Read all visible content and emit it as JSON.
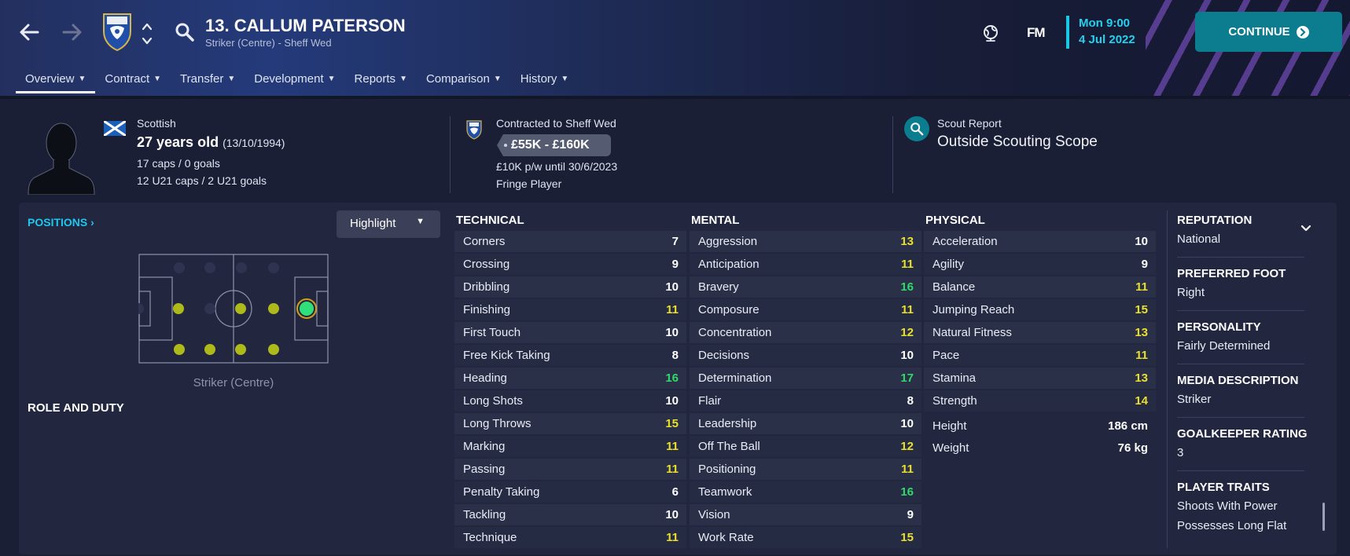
{
  "header": {
    "player_title": "13. CALLUM PATERSON",
    "player_subtitle": "Striker (Centre) - Sheff Wed",
    "back_icon": "arrow-left-icon",
    "forward_icon": "arrow-right-icon",
    "club_crest": "sheff-wed-crest-icon",
    "fm_logo": "FM",
    "date_time": "Mon 9:00",
    "date_day": "4 Jul 2022",
    "continue_label": "CONTINUE"
  },
  "tabs": [
    {
      "label": "Overview",
      "active": true
    },
    {
      "label": "Contract"
    },
    {
      "label": "Transfer"
    },
    {
      "label": "Development"
    },
    {
      "label": "Reports"
    },
    {
      "label": "Comparison"
    },
    {
      "label": "History"
    }
  ],
  "info": {
    "nationality": "Scottish",
    "age": "27 years old",
    "dob": "(13/10/1994)",
    "caps": "17 caps / 0 goals",
    "u21_caps": "12 U21 caps / 2 U21 goals",
    "contracted_to": "Contracted to Sheff Wed",
    "value": "£55K - £160K",
    "wage": "£10K p/w until 30/6/2023",
    "squad_status": "Fringe Player",
    "scout_label": "Scout Report",
    "scout_value": "Outside Scouting Scope"
  },
  "positions": {
    "link_label": "POSITIONS",
    "highlight_label": "Highlight",
    "position_label": "Striker (Centre)",
    "role_duty_label": "ROLE AND DUTY"
  },
  "technical": {
    "heading": "TECHNICAL",
    "rows": [
      {
        "name": "Corners",
        "value": "7",
        "tone": "white"
      },
      {
        "name": "Crossing",
        "value": "9",
        "tone": "white"
      },
      {
        "name": "Dribbling",
        "value": "10",
        "tone": "white"
      },
      {
        "name": "Finishing",
        "value": "11",
        "tone": "yellow"
      },
      {
        "name": "First Touch",
        "value": "10",
        "tone": "white"
      },
      {
        "name": "Free Kick Taking",
        "value": "8",
        "tone": "white"
      },
      {
        "name": "Heading",
        "value": "16",
        "tone": "green"
      },
      {
        "name": "Long Shots",
        "value": "10",
        "tone": "white"
      },
      {
        "name": "Long Throws",
        "value": "15",
        "tone": "yellow"
      },
      {
        "name": "Marking",
        "value": "11",
        "tone": "yellow"
      },
      {
        "name": "Passing",
        "value": "11",
        "tone": "yellow"
      },
      {
        "name": "Penalty Taking",
        "value": "6",
        "tone": "white"
      },
      {
        "name": "Tackling",
        "value": "10",
        "tone": "white"
      },
      {
        "name": "Technique",
        "value": "11",
        "tone": "yellow"
      }
    ]
  },
  "mental": {
    "heading": "MENTAL",
    "rows": [
      {
        "name": "Aggression",
        "value": "13",
        "tone": "yellow"
      },
      {
        "name": "Anticipation",
        "value": "11",
        "tone": "yellow"
      },
      {
        "name": "Bravery",
        "value": "16",
        "tone": "green"
      },
      {
        "name": "Composure",
        "value": "11",
        "tone": "yellow"
      },
      {
        "name": "Concentration",
        "value": "12",
        "tone": "yellow"
      },
      {
        "name": "Decisions",
        "value": "10",
        "tone": "white"
      },
      {
        "name": "Determination",
        "value": "17",
        "tone": "green"
      },
      {
        "name": "Flair",
        "value": "8",
        "tone": "white"
      },
      {
        "name": "Leadership",
        "value": "10",
        "tone": "white"
      },
      {
        "name": "Off The Ball",
        "value": "12",
        "tone": "yellow"
      },
      {
        "name": "Positioning",
        "value": "11",
        "tone": "yellow"
      },
      {
        "name": "Teamwork",
        "value": "16",
        "tone": "green"
      },
      {
        "name": "Vision",
        "value": "9",
        "tone": "white"
      },
      {
        "name": "Work Rate",
        "value": "15",
        "tone": "yellow"
      }
    ]
  },
  "physical": {
    "heading": "PHYSICAL",
    "rows": [
      {
        "name": "Acceleration",
        "value": "10",
        "tone": "white"
      },
      {
        "name": "Agility",
        "value": "9",
        "tone": "white"
      },
      {
        "name": "Balance",
        "value": "11",
        "tone": "yellow"
      },
      {
        "name": "Jumping Reach",
        "value": "15",
        "tone": "yellow"
      },
      {
        "name": "Natural Fitness",
        "value": "13",
        "tone": "yellow"
      },
      {
        "name": "Pace",
        "value": "11",
        "tone": "yellow"
      },
      {
        "name": "Stamina",
        "value": "13",
        "tone": "yellow"
      },
      {
        "name": "Strength",
        "value": "14",
        "tone": "yellow"
      }
    ],
    "height_label": "Height",
    "height_value": "186 cm",
    "weight_label": "Weight",
    "weight_value": "76 kg"
  },
  "side": {
    "reputation_title": "REPUTATION",
    "reputation_value": "National",
    "foot_title": "PREFERRED FOOT",
    "foot_value": "Right",
    "personality_title": "PERSONALITY",
    "personality_value": "Fairly Determined",
    "media_title": "MEDIA DESCRIPTION",
    "media_value": "Striker",
    "gk_title": "GOALKEEPER RATING",
    "gk_value": "3",
    "traits_title": "PLAYER TRAITS",
    "traits": [
      "Shoots With Power",
      "Possesses Long Flat"
    ]
  },
  "colors": {
    "accent": "#0b7d8e",
    "date_cyan": "#26d0ee",
    "attr_yellow": "#e9e02c",
    "attr_green": "#2fd96a",
    "position_dot_natural": "#2fe07a",
    "position_dot_other": "#aeba1a"
  }
}
